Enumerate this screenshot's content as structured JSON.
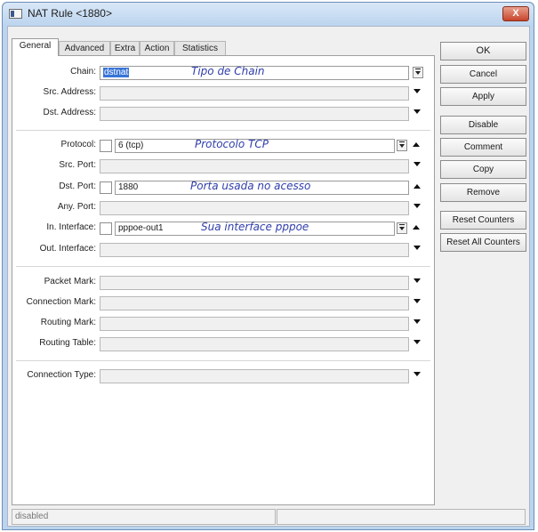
{
  "window": {
    "title": "NAT Rule <1880>",
    "close_glyph": "X"
  },
  "tabs": [
    {
      "label": "General",
      "active": true
    },
    {
      "label": "Advanced",
      "active": false
    },
    {
      "label": "Extra",
      "active": false
    },
    {
      "label": "Action",
      "active": false
    },
    {
      "label": "Statistics",
      "active": false
    }
  ],
  "fields": {
    "chain": {
      "label": "Chain:",
      "value": "dstnat"
    },
    "src_address": {
      "label": "Src. Address:",
      "value": ""
    },
    "dst_address": {
      "label": "Dst. Address:",
      "value": ""
    },
    "protocol": {
      "label": "Protocol:",
      "value": "6 (tcp)"
    },
    "src_port": {
      "label": "Src. Port:",
      "value": ""
    },
    "dst_port": {
      "label": "Dst. Port:",
      "value": "1880"
    },
    "any_port": {
      "label": "Any. Port:",
      "value": ""
    },
    "in_interface": {
      "label": "In. Interface:",
      "value": "pppoe-out1"
    },
    "out_interface": {
      "label": "Out. Interface:",
      "value": ""
    },
    "packet_mark": {
      "label": "Packet Mark:",
      "value": ""
    },
    "connection_mark": {
      "label": "Connection Mark:",
      "value": ""
    },
    "routing_mark": {
      "label": "Routing Mark:",
      "value": ""
    },
    "routing_table": {
      "label": "Routing Table:",
      "value": ""
    },
    "connection_type": {
      "label": "Connection Type:",
      "value": ""
    }
  },
  "annotations": {
    "chain": "Tipo de Chain",
    "protocol": "Protocolo TCP",
    "dst_port": "Porta usada no acesso",
    "in_interface": "Sua interface pppoe"
  },
  "buttons": {
    "ok": "OK",
    "cancel": "Cancel",
    "apply": "Apply",
    "disable": "Disable",
    "comment": "Comment",
    "copy": "Copy",
    "remove": "Remove",
    "reset_counters": "Reset Counters",
    "reset_all_counters": "Reset All Counters"
  },
  "status": {
    "text": "disabled"
  },
  "colors": {
    "annotation": "#2f3eaa",
    "selection": "#3875d7",
    "titlebar": "#bcd4ee",
    "close": "#c8442a"
  }
}
